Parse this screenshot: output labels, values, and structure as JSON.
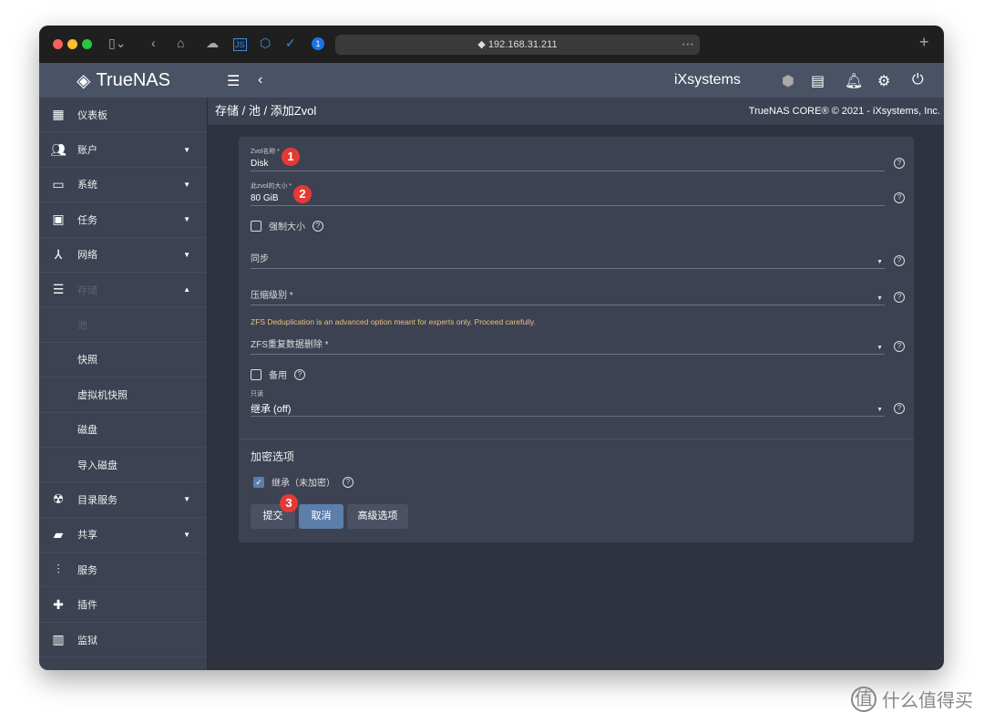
{
  "browser": {
    "url": "192.168.31.211"
  },
  "header": {
    "brand": "TrueNAS",
    "brand_sub": "CORE",
    "vendor": "iXsystems"
  },
  "breadcrumb": [
    "存储",
    "池",
    "添加Zvol"
  ],
  "copyright": "TrueNAS CORE® © 2021 - iXsystems, Inc.",
  "sidebar": {
    "items": [
      {
        "label": "仪表板",
        "icon": "dashboard-icon"
      },
      {
        "label": "账户",
        "icon": "people-icon",
        "caret": "▼"
      },
      {
        "label": "系统",
        "icon": "laptop-icon",
        "caret": "▼"
      },
      {
        "label": "任务",
        "icon": "calendar-icon",
        "caret": "▼"
      },
      {
        "label": "网络",
        "icon": "network-icon",
        "caret": "▼"
      },
      {
        "label": "存储",
        "icon": "list-icon",
        "caret": "▲"
      },
      {
        "label": "池"
      },
      {
        "label": "快照"
      },
      {
        "label": "虚拟机快照"
      },
      {
        "label": "磁盘"
      },
      {
        "label": "导入磁盘"
      },
      {
        "label": "目录服务",
        "icon": "directory-icon",
        "caret": "▼"
      },
      {
        "label": "共享",
        "icon": "folder-share-icon",
        "caret": "▼"
      },
      {
        "label": "服务",
        "icon": "sliders-icon"
      },
      {
        "label": "插件",
        "icon": "puzzle-icon"
      },
      {
        "label": "监狱",
        "icon": "jail-icon"
      }
    ]
  },
  "form": {
    "name_label": "Zvol名称 *",
    "name_value": "Disk",
    "size_label": "此zvol的大小 *",
    "size_value": "80 GiB",
    "force_size": "强制大小",
    "sync": "同步",
    "compression": "压缩级别 *",
    "dedup_warning": "ZFS Deduplication is an advanced option meant for experts only. Proceed carefully.",
    "dedup": "ZFS重复数据删除 *",
    "sparse": "备用",
    "readonly_label": "只读",
    "readonly_value": "继承 (off)",
    "encryption_title": "加密选项",
    "inherit_encryption": "继承（未加密）",
    "submit": "提交",
    "cancel": "取消",
    "advanced": "高级选项"
  },
  "badges": [
    "1",
    "2",
    "3"
  ],
  "watermark": "什么值得买",
  "colors": {
    "accent": "#5b7eaa",
    "warning": "#e8c07a",
    "badge": "#e53935"
  }
}
